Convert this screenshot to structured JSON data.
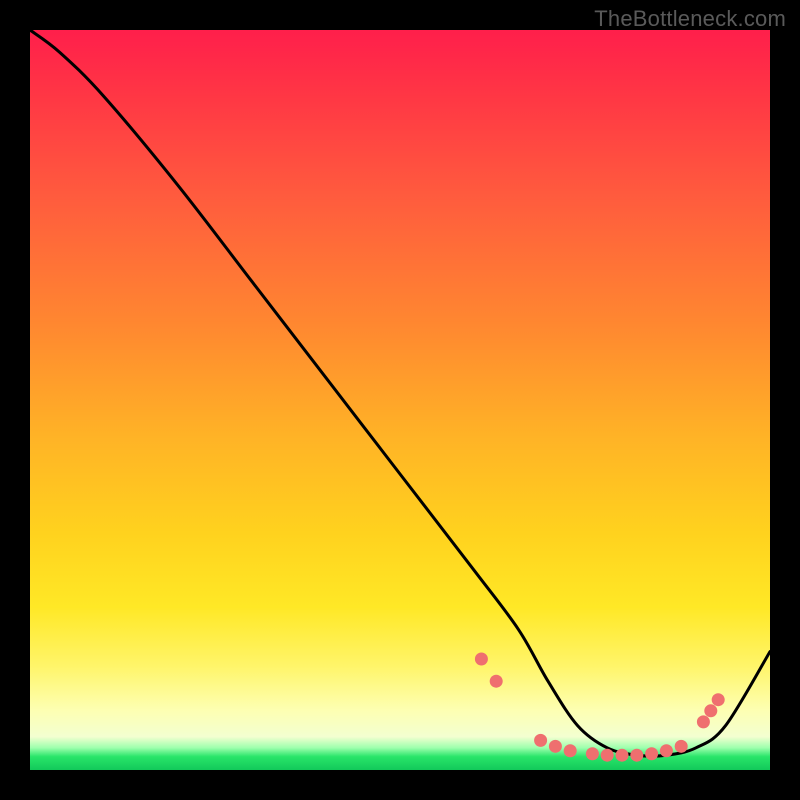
{
  "watermark": "TheBottleneck.com",
  "colors": {
    "background": "#000000",
    "curve": "#000000",
    "marker": "#ef6f6f",
    "gradient_top": "#ff1f4b",
    "gradient_bottom": "#12c95a"
  },
  "chart_data": {
    "type": "line",
    "title": "",
    "xlabel": "",
    "ylabel": "",
    "xlim": [
      0,
      100
    ],
    "ylim": [
      0,
      100
    ],
    "grid": false,
    "annotations": [
      "TheBottleneck.com"
    ],
    "series": [
      {
        "name": "bottleneck-curve",
        "x": [
          0,
          4,
          10,
          20,
          30,
          40,
          50,
          60,
          66,
          70,
          74,
          78,
          82,
          86,
          90,
          94,
          100
        ],
        "y": [
          100,
          97,
          91,
          79,
          66,
          53,
          40,
          27,
          19,
          12,
          6,
          3,
          2,
          2,
          3,
          6,
          16
        ]
      }
    ],
    "markers": [
      {
        "x": 61,
        "y": 15
      },
      {
        "x": 63,
        "y": 12
      },
      {
        "x": 69,
        "y": 4
      },
      {
        "x": 71,
        "y": 3.2
      },
      {
        "x": 73,
        "y": 2.6
      },
      {
        "x": 76,
        "y": 2.2
      },
      {
        "x": 78,
        "y": 2.0
      },
      {
        "x": 80,
        "y": 2.0
      },
      {
        "x": 82,
        "y": 2.0
      },
      {
        "x": 84,
        "y": 2.2
      },
      {
        "x": 86,
        "y": 2.6
      },
      {
        "x": 88,
        "y": 3.2
      },
      {
        "x": 91,
        "y": 6.5
      },
      {
        "x": 92,
        "y": 8
      },
      {
        "x": 93,
        "y": 9.5
      }
    ]
  }
}
